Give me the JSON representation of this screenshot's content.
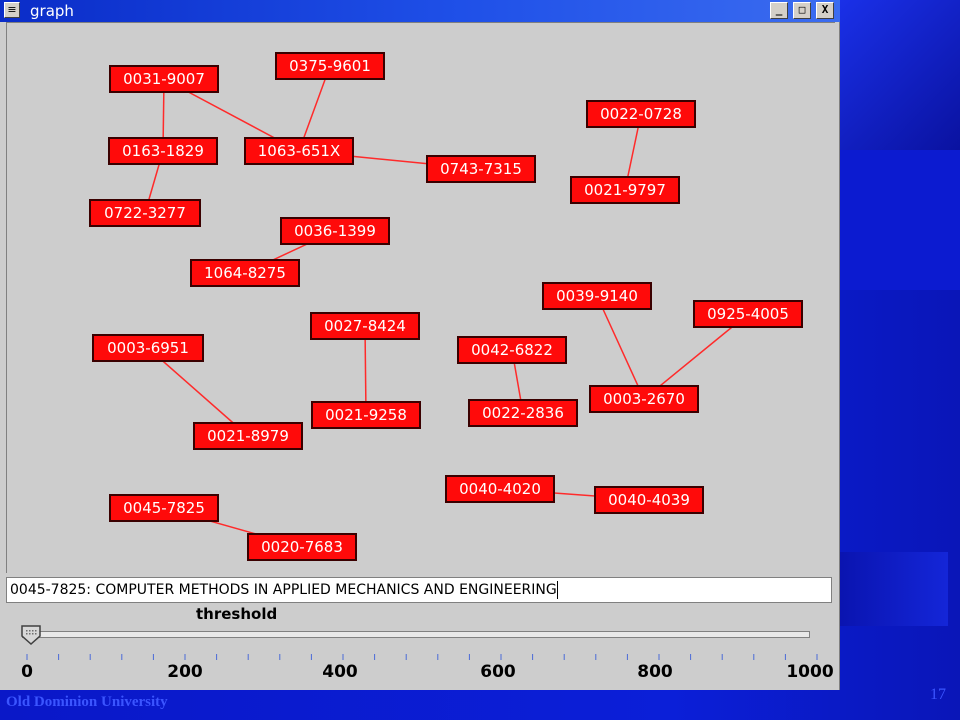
{
  "window": {
    "title": "graph",
    "controls": {
      "minimize": "_",
      "maximize": "□",
      "close": "X"
    },
    "sysmenu_icon": "menu-lines-icon"
  },
  "nodes": [
    {
      "id": "n1",
      "label": "0031-9007"
    },
    {
      "id": "n2",
      "label": "0375-9601"
    },
    {
      "id": "n3",
      "label": "0163-1829"
    },
    {
      "id": "n4",
      "label": "1063-651X"
    },
    {
      "id": "n5",
      "label": "0743-7315"
    },
    {
      "id": "n6",
      "label": "0722-3277"
    },
    {
      "id": "n7",
      "label": "0022-0728"
    },
    {
      "id": "n8",
      "label": "0021-9797"
    },
    {
      "id": "n9",
      "label": "0036-1399"
    },
    {
      "id": "n10",
      "label": "1064-8275"
    },
    {
      "id": "n11",
      "label": "0039-9140"
    },
    {
      "id": "n12",
      "label": "0925-4005"
    },
    {
      "id": "n13",
      "label": "0027-8424"
    },
    {
      "id": "n14",
      "label": "0003-6951"
    },
    {
      "id": "n15",
      "label": "0042-6822"
    },
    {
      "id": "n16",
      "label": "0003-2670"
    },
    {
      "id": "n17",
      "label": "0022-2836"
    },
    {
      "id": "n18",
      "label": "0021-9258"
    },
    {
      "id": "n19",
      "label": "0021-8979"
    },
    {
      "id": "n20",
      "label": "0040-4020"
    },
    {
      "id": "n21",
      "label": "0040-4039"
    },
    {
      "id": "n22",
      "label": "0045-7825"
    },
    {
      "id": "n23",
      "label": "0020-7683"
    }
  ],
  "edges": [
    [
      "n1",
      "n3"
    ],
    [
      "n1",
      "n4"
    ],
    [
      "n2",
      "n4"
    ],
    [
      "n4",
      "n5"
    ],
    [
      "n3",
      "n6"
    ],
    [
      "n7",
      "n8"
    ],
    [
      "n9",
      "n10"
    ],
    [
      "n11",
      "n16"
    ],
    [
      "n12",
      "n16"
    ],
    [
      "n15",
      "n17"
    ],
    [
      "n13",
      "n18"
    ],
    [
      "n14",
      "n19"
    ],
    [
      "n20",
      "n21"
    ],
    [
      "n22",
      "n23"
    ]
  ],
  "colors": {
    "node_fill": "#ff0a0a",
    "edge": "#ff2a2a",
    "canvas_bg": "#cdcdcd"
  },
  "info_field": {
    "value": "0045-7825: COMPUTER METHODS IN APPLIED MECHANICS AND ENGINEERING"
  },
  "slider": {
    "label": "threshold",
    "value": 0,
    "min": 0,
    "max": 1000,
    "tick_labels": [
      "0",
      "200",
      "400",
      "600",
      "800",
      "1000"
    ]
  },
  "slide": {
    "footer": "Old Dominion University",
    "page_number": "17"
  }
}
